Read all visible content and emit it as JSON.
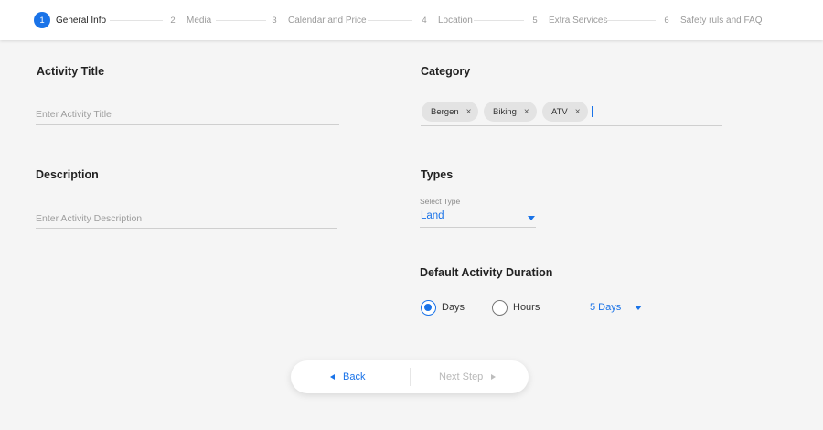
{
  "stepper": {
    "steps": [
      {
        "num": "1",
        "label": "General Info",
        "active": true
      },
      {
        "num": "2",
        "label": "Media",
        "active": false
      },
      {
        "num": "3",
        "label": "Calendar and Price",
        "active": false
      },
      {
        "num": "4",
        "label": "Location",
        "active": false
      },
      {
        "num": "5",
        "label": "Extra Services",
        "active": false
      },
      {
        "num": "6",
        "label": "Safety ruls and FAQ",
        "active": false
      }
    ]
  },
  "form": {
    "activity_title": {
      "label": "Activity Title",
      "placeholder": "Enter Activity Title",
      "value": ""
    },
    "description": {
      "label": "Description",
      "placeholder": "Enter Activity Description",
      "value": ""
    },
    "category": {
      "label": "Category",
      "chips": [
        "Bergen",
        "Biking",
        "ATV"
      ],
      "remove_icon": "×"
    },
    "types": {
      "label": "Types",
      "select_label": "Select Type",
      "value": "Land"
    },
    "duration": {
      "label": "Default Activity Duration",
      "options": [
        {
          "label": "Days",
          "selected": true
        },
        {
          "label": "Hours",
          "selected": false
        }
      ],
      "amount": "5 Days"
    }
  },
  "nav": {
    "back_label": "Back",
    "next_label": "Next Step"
  },
  "colors": {
    "accent": "#1a73e8",
    "chip_bg": "#e3e3e3",
    "page_bg": "#f5f5f5"
  }
}
